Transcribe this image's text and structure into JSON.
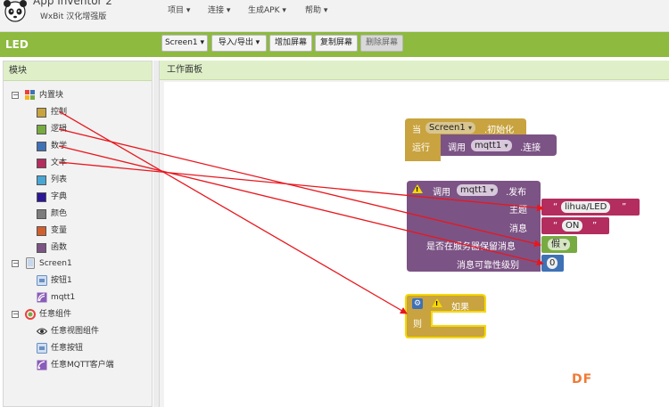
{
  "header": {
    "app_name": "App Inventor 2",
    "app_subtitle": "WxBit 汉化增强版",
    "menu": [
      "项目 ▾",
      "连接 ▾",
      "生成APK ▾",
      "帮助 ▾"
    ]
  },
  "toolbar": {
    "project_name": "LED",
    "screen_select": "Screen1 ▾",
    "import_export": "导入/导出 ▾",
    "add_screen": "增加屏幕",
    "copy_screen": "复制屏幕",
    "delete_screen": "删除屏幕"
  },
  "blocks_panel": {
    "title": "模块",
    "builtin": {
      "label": "内置块",
      "items": [
        {
          "label": "控制",
          "color": "#c8a33f"
        },
        {
          "label": "逻辑",
          "color": "#77ab41"
        },
        {
          "label": "数学",
          "color": "#3f71b5"
        },
        {
          "label": "文本",
          "color": "#b32d5e"
        },
        {
          "label": "列表",
          "color": "#49a6d4"
        },
        {
          "label": "字典",
          "color": "#2d1799"
        },
        {
          "label": "颜色",
          "color": "#7d7d7d"
        },
        {
          "label": "变量",
          "color": "#d05f2d"
        },
        {
          "label": "函数",
          "color": "#7c5385"
        }
      ]
    },
    "screen": {
      "label": "Screen1",
      "items": [
        {
          "label": "按钮1"
        },
        {
          "label": "mqtt1"
        }
      ]
    },
    "any_component": {
      "label": "任意组件",
      "items": [
        {
          "label": "任意视图组件"
        },
        {
          "label": "任意按钮"
        },
        {
          "label": "任意MQTT客户端"
        }
      ]
    }
  },
  "viewer": {
    "title": "工作面板"
  },
  "blocks": {
    "init": {
      "when": "当",
      "component": "Screen1",
      "event": ".初始化",
      "do": "运行",
      "call": "调用",
      "call_component": "mqtt1",
      "method": ".连接"
    },
    "publish": {
      "call": "调用",
      "component": "mqtt1",
      "method": ".发布",
      "topic_label": "主题",
      "topic_value": "lihua/LED",
      "message_label": "消息",
      "message_value": "ON",
      "retain_label": "是否在服务器保留消息",
      "retain_value": "假",
      "qos_label": "消息可靠性级别",
      "qos_value": "0"
    },
    "if_block": {
      "if_label": "如果",
      "then_label": "则"
    }
  },
  "watermark": "DF",
  "colors": {
    "green_bar": "#8dba3f",
    "control": "#c8a33f",
    "component_purple": "#7c5385",
    "text_block": "#b32d5e",
    "logic_block": "#77ab41",
    "math_block": "#3f71b5",
    "arrow": "#e8171e"
  }
}
